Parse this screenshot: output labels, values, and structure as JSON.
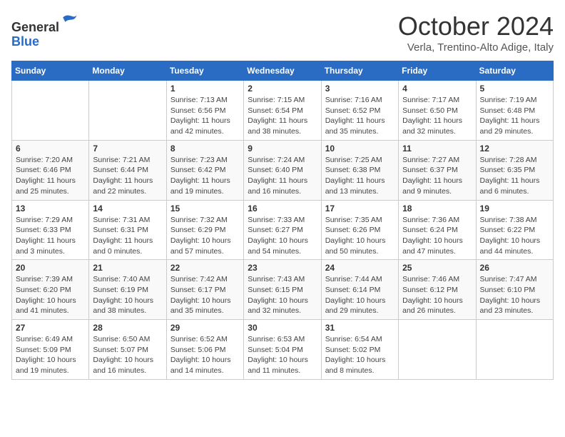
{
  "header": {
    "logo": {
      "general": "General",
      "blue": "Blue"
    },
    "title": "October 2024",
    "subtitle": "Verla, Trentino-Alto Adige, Italy"
  },
  "calendar": {
    "days_of_week": [
      "Sunday",
      "Monday",
      "Tuesday",
      "Wednesday",
      "Thursday",
      "Friday",
      "Saturday"
    ],
    "weeks": [
      [
        {
          "day": "",
          "info": ""
        },
        {
          "day": "",
          "info": ""
        },
        {
          "day": "1",
          "info": "Sunrise: 7:13 AM\nSunset: 6:56 PM\nDaylight: 11 hours and 42 minutes."
        },
        {
          "day": "2",
          "info": "Sunrise: 7:15 AM\nSunset: 6:54 PM\nDaylight: 11 hours and 38 minutes."
        },
        {
          "day": "3",
          "info": "Sunrise: 7:16 AM\nSunset: 6:52 PM\nDaylight: 11 hours and 35 minutes."
        },
        {
          "day": "4",
          "info": "Sunrise: 7:17 AM\nSunset: 6:50 PM\nDaylight: 11 hours and 32 minutes."
        },
        {
          "day": "5",
          "info": "Sunrise: 7:19 AM\nSunset: 6:48 PM\nDaylight: 11 hours and 29 minutes."
        }
      ],
      [
        {
          "day": "6",
          "info": "Sunrise: 7:20 AM\nSunset: 6:46 PM\nDaylight: 11 hours and 25 minutes."
        },
        {
          "day": "7",
          "info": "Sunrise: 7:21 AM\nSunset: 6:44 PM\nDaylight: 11 hours and 22 minutes."
        },
        {
          "day": "8",
          "info": "Sunrise: 7:23 AM\nSunset: 6:42 PM\nDaylight: 11 hours and 19 minutes."
        },
        {
          "day": "9",
          "info": "Sunrise: 7:24 AM\nSunset: 6:40 PM\nDaylight: 11 hours and 16 minutes."
        },
        {
          "day": "10",
          "info": "Sunrise: 7:25 AM\nSunset: 6:38 PM\nDaylight: 11 hours and 13 minutes."
        },
        {
          "day": "11",
          "info": "Sunrise: 7:27 AM\nSunset: 6:37 PM\nDaylight: 11 hours and 9 minutes."
        },
        {
          "day": "12",
          "info": "Sunrise: 7:28 AM\nSunset: 6:35 PM\nDaylight: 11 hours and 6 minutes."
        }
      ],
      [
        {
          "day": "13",
          "info": "Sunrise: 7:29 AM\nSunset: 6:33 PM\nDaylight: 11 hours and 3 minutes."
        },
        {
          "day": "14",
          "info": "Sunrise: 7:31 AM\nSunset: 6:31 PM\nDaylight: 11 hours and 0 minutes."
        },
        {
          "day": "15",
          "info": "Sunrise: 7:32 AM\nSunset: 6:29 PM\nDaylight: 10 hours and 57 minutes."
        },
        {
          "day": "16",
          "info": "Sunrise: 7:33 AM\nSunset: 6:27 PM\nDaylight: 10 hours and 54 minutes."
        },
        {
          "day": "17",
          "info": "Sunrise: 7:35 AM\nSunset: 6:26 PM\nDaylight: 10 hours and 50 minutes."
        },
        {
          "day": "18",
          "info": "Sunrise: 7:36 AM\nSunset: 6:24 PM\nDaylight: 10 hours and 47 minutes."
        },
        {
          "day": "19",
          "info": "Sunrise: 7:38 AM\nSunset: 6:22 PM\nDaylight: 10 hours and 44 minutes."
        }
      ],
      [
        {
          "day": "20",
          "info": "Sunrise: 7:39 AM\nSunset: 6:20 PM\nDaylight: 10 hours and 41 minutes."
        },
        {
          "day": "21",
          "info": "Sunrise: 7:40 AM\nSunset: 6:19 PM\nDaylight: 10 hours and 38 minutes."
        },
        {
          "day": "22",
          "info": "Sunrise: 7:42 AM\nSunset: 6:17 PM\nDaylight: 10 hours and 35 minutes."
        },
        {
          "day": "23",
          "info": "Sunrise: 7:43 AM\nSunset: 6:15 PM\nDaylight: 10 hours and 32 minutes."
        },
        {
          "day": "24",
          "info": "Sunrise: 7:44 AM\nSunset: 6:14 PM\nDaylight: 10 hours and 29 minutes."
        },
        {
          "day": "25",
          "info": "Sunrise: 7:46 AM\nSunset: 6:12 PM\nDaylight: 10 hours and 26 minutes."
        },
        {
          "day": "26",
          "info": "Sunrise: 7:47 AM\nSunset: 6:10 PM\nDaylight: 10 hours and 23 minutes."
        }
      ],
      [
        {
          "day": "27",
          "info": "Sunrise: 6:49 AM\nSunset: 5:09 PM\nDaylight: 10 hours and 19 minutes."
        },
        {
          "day": "28",
          "info": "Sunrise: 6:50 AM\nSunset: 5:07 PM\nDaylight: 10 hours and 16 minutes."
        },
        {
          "day": "29",
          "info": "Sunrise: 6:52 AM\nSunset: 5:06 PM\nDaylight: 10 hours and 14 minutes."
        },
        {
          "day": "30",
          "info": "Sunrise: 6:53 AM\nSunset: 5:04 PM\nDaylight: 10 hours and 11 minutes."
        },
        {
          "day": "31",
          "info": "Sunrise: 6:54 AM\nSunset: 5:02 PM\nDaylight: 10 hours and 8 minutes."
        },
        {
          "day": "",
          "info": ""
        },
        {
          "day": "",
          "info": ""
        }
      ]
    ]
  }
}
